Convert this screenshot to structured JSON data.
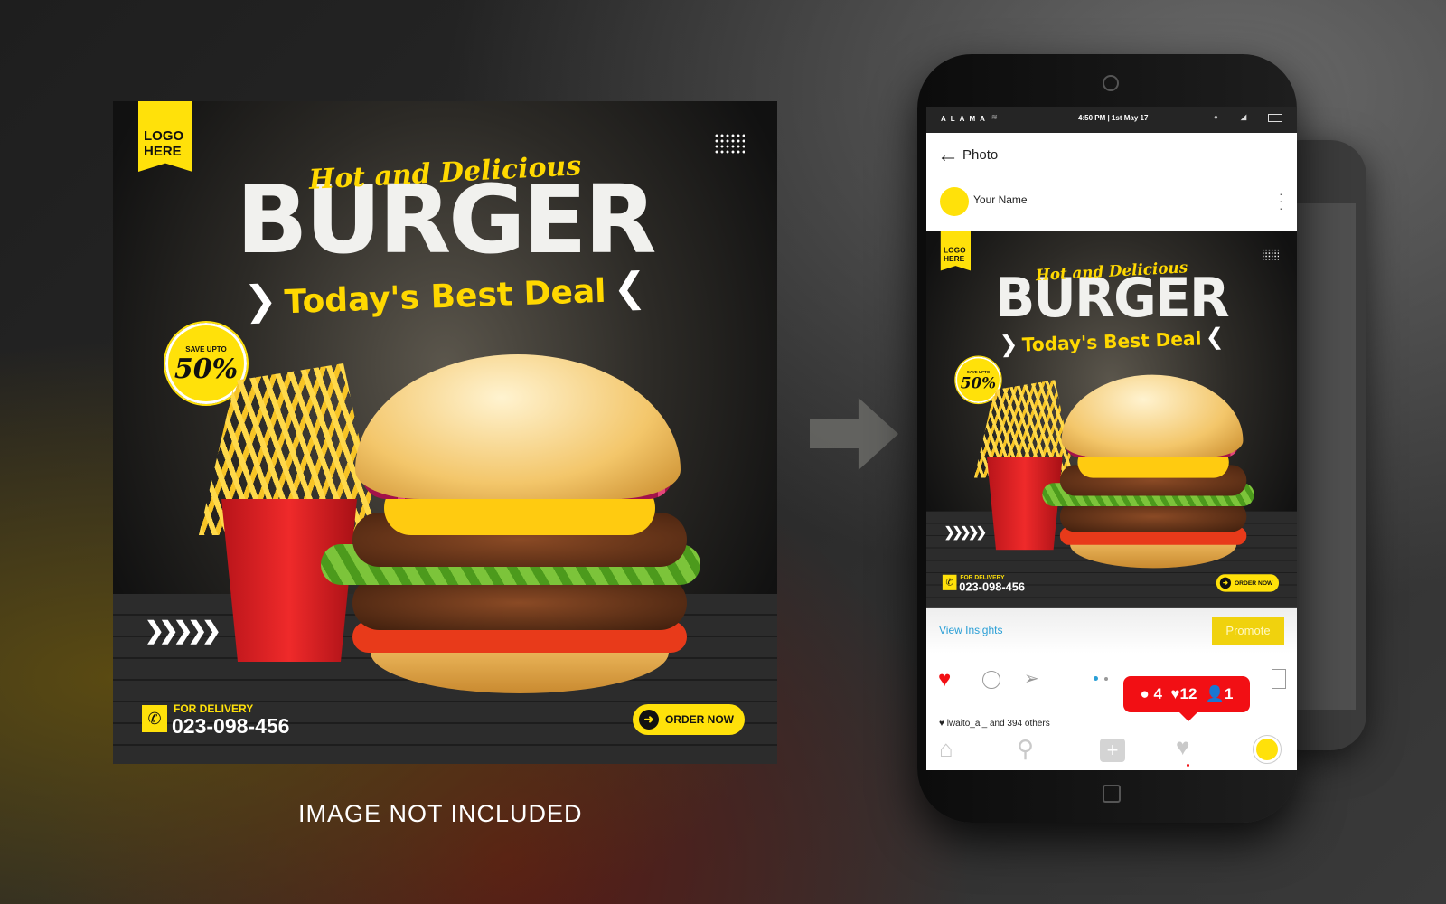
{
  "poster": {
    "logo": "LOGO HERE",
    "subtitle": "Hot and Delicious",
    "title": "BURGER",
    "deal": "Today's Best Deal",
    "save_label": "SAVE UPTO",
    "save_value": "50%",
    "delivery_label": "FOR DELIVERY",
    "phone": "023-098-456",
    "order_button": "ORDER NOW"
  },
  "caption": "IMAGE NOT INCLUDED",
  "phone": {
    "status": {
      "carrier": "ALAMA",
      "time": "4:50 PM | 1st May 17"
    },
    "header": {
      "title": "Photo",
      "username": "Your Name"
    },
    "insights_link": "View Insights",
    "promote_button": "Promote",
    "likes_text": "lwaito_al_ and 394 others",
    "notification": {
      "comments": "4",
      "likes": "12",
      "followers": "1"
    },
    "colors": {
      "accent": "#ffe10a",
      "like": "#f20f14",
      "link": "#2a9fd6"
    }
  }
}
